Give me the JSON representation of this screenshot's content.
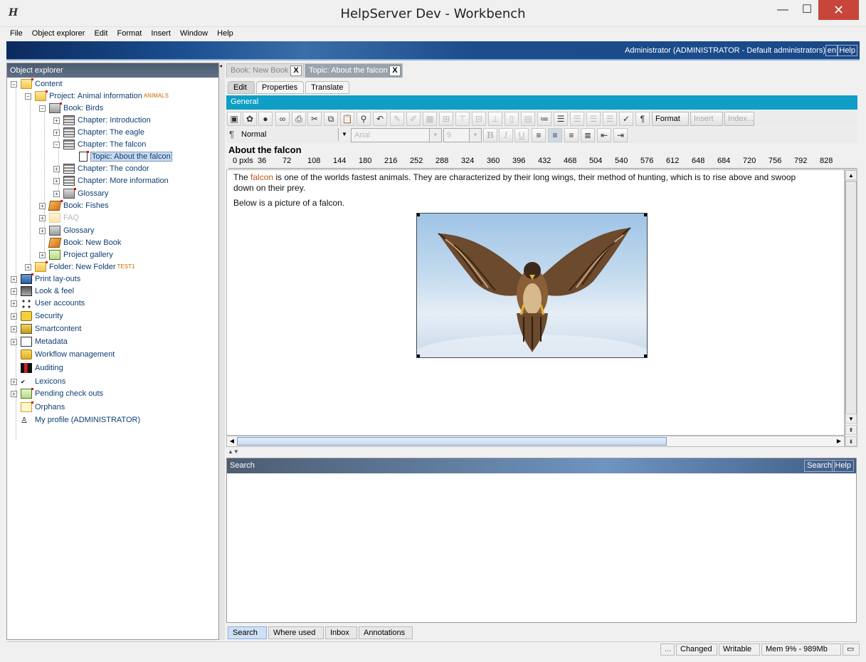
{
  "window": {
    "title": "HelpServer Dev - Workbench",
    "minimize": "—",
    "maximize": "☐",
    "close": "✕",
    "app_icon": "H"
  },
  "menu": [
    "File",
    "Object explorer",
    "Edit",
    "Format",
    "Insert",
    "Window",
    "Help"
  ],
  "banner": {
    "user": "Administrator (ADMINISTRATOR - Default administrators)",
    "lang": "en",
    "help": "Help"
  },
  "object_explorer": {
    "title": "Object explorer",
    "nodes": [
      {
        "label": "Content",
        "icon": "folder-icon"
      },
      {
        "label": "Project: Animal information",
        "badge": "ANIMALS",
        "icon": "project-icon"
      },
      {
        "label": "Book: Birds",
        "icon": "book-icon"
      },
      {
        "label": "Chapter: Introduction",
        "icon": "chapter-icon"
      },
      {
        "label": "Chapter: The eagle",
        "icon": "chapter-icon"
      },
      {
        "label": "Chapter: The falcon",
        "icon": "chapter-icon"
      },
      {
        "label": "Topic: About the falcon",
        "icon": "topic-icon"
      },
      {
        "label": "Chapter: The condor",
        "icon": "chapter-icon"
      },
      {
        "label": "Chapter: More information",
        "icon": "chapter-icon"
      },
      {
        "label": "Glossary",
        "icon": "glossary-icon"
      },
      {
        "label": "Book: Fishes",
        "icon": "book-icon"
      },
      {
        "label": "FAQ",
        "icon": "faq-icon"
      },
      {
        "label": "Glossary",
        "icon": "glossary-icon"
      },
      {
        "label": "Book: New Book",
        "icon": "book-icon"
      },
      {
        "label": "Project gallery",
        "icon": "gallery-icon"
      },
      {
        "label": "Folder: New Folder",
        "badge": "TEST1",
        "icon": "folder-icon"
      },
      {
        "label": "Print lay-outs",
        "icon": "printer-icon"
      },
      {
        "label": "Look & feel",
        "icon": "look-feel-icon"
      },
      {
        "label": "User accounts",
        "icon": "users-icon"
      },
      {
        "label": "Security",
        "icon": "lock-icon"
      },
      {
        "label": "Smartcontent",
        "icon": "smartcontent-icon"
      },
      {
        "label": "Metadata",
        "icon": "metadata-icon"
      },
      {
        "label": "Workflow management",
        "icon": "workflow-icon"
      },
      {
        "label": "Auditing",
        "icon": "auditing-icon"
      },
      {
        "label": "Lexicons",
        "icon": "lexicon-icon"
      },
      {
        "label": "Pending check outs",
        "icon": "pending-icon"
      },
      {
        "label": "Orphans",
        "icon": "orphans-icon"
      },
      {
        "label": "My profile (ADMINISTRATOR)",
        "icon": "profile-icon"
      }
    ]
  },
  "doc_tabs": [
    {
      "label": "Book: New Book",
      "close": "X"
    },
    {
      "label": "Topic: About the falcon",
      "close": "X"
    }
  ],
  "sub_tabs": [
    "Edit",
    "Properties",
    "Translate"
  ],
  "section": "General",
  "toolbar": {
    "format": "Format",
    "insert": "Insert",
    "index": "Index..."
  },
  "formatbar": {
    "style": "Normal",
    "font": "Arial",
    "size": "9",
    "bold": "B",
    "italic": "I",
    "underline": "U",
    "para_mark": "¶"
  },
  "document": {
    "title": "About the falcon",
    "ruler": [
      "0 pxls",
      "36",
      "72",
      "108",
      "144",
      "180",
      "216",
      "252",
      "288",
      "324",
      "360",
      "396",
      "432",
      "468",
      "504",
      "540",
      "576",
      "612",
      "648",
      "684",
      "720",
      "756",
      "792",
      "828"
    ],
    "p1_before": "The ",
    "p1_keyword": "falcon",
    "p1_after": " is one of the worlds fastest animals. They are characterized by their long wings, their method of hunting, which is to rise above and swoop",
    "p1_line2": "down on their prey.",
    "p2": "Below is a picture of a falcon."
  },
  "search": {
    "title": "Search",
    "search_btn": "Search",
    "help_btn": "Help",
    "tabs": [
      "Search",
      "Where used",
      "Inbox",
      "Annotations"
    ]
  },
  "status": {
    "more": "...",
    "changed": "Changed",
    "writable": "Writable",
    "memory": "Mem 9% - 989Mb"
  }
}
